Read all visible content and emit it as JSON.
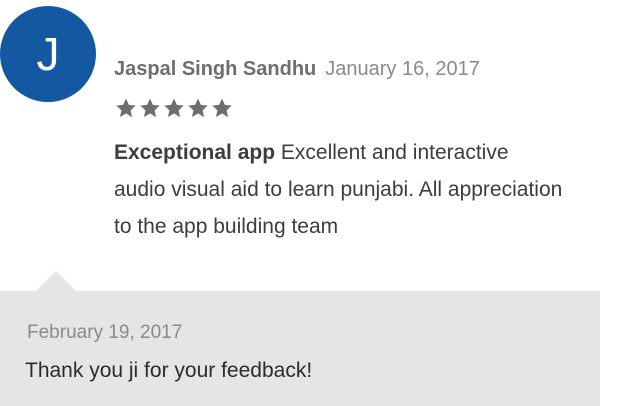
{
  "review": {
    "avatar_initial": "J",
    "avatar_color": "#1558a2",
    "author": "Jaspal Singh Sandhu",
    "date": "January 16, 2017",
    "rating": 5,
    "rating_max": 5,
    "title": "Exceptional app",
    "text": "Excellent and interactive audio visual aid to learn punjabi. All appreciation to the app building team"
  },
  "reply": {
    "date": "February 19, 2017",
    "text": "Thank you ji for your feedback!",
    "background_color": "#e5e5e5"
  },
  "icons": {
    "star": "star-icon"
  }
}
